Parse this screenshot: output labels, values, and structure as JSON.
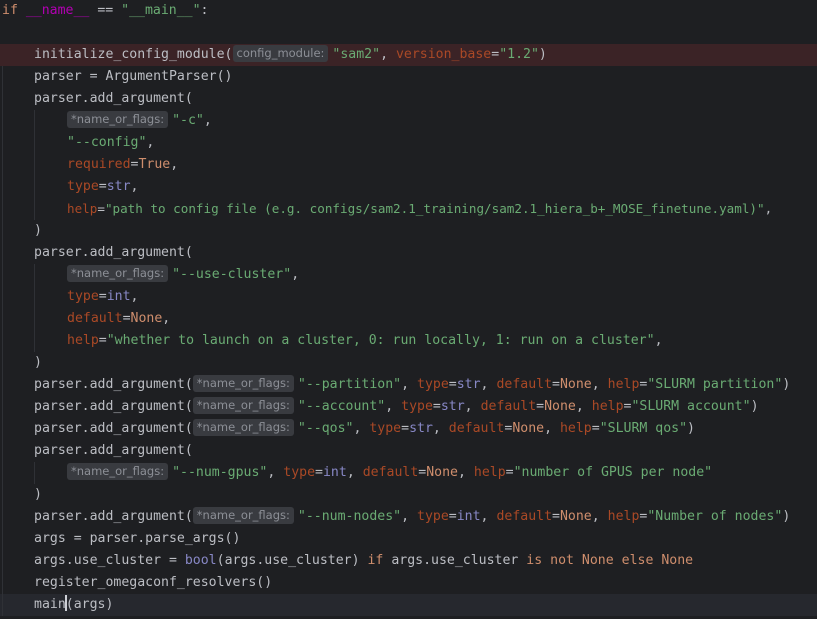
{
  "editor": {
    "colors": {
      "background": "#1e1f22",
      "breakpoint_line": "#3b2326",
      "current_line": "#26282e",
      "keyword": "#cf8e6d",
      "string": "#6aab73",
      "named_parameter": "#aa4926",
      "builtin": "#8888c6",
      "default_text": "#bcbec4",
      "inlay_hint_bg": "#393b40",
      "inlay_hint_fg": "#8c8f96"
    },
    "hints": {
      "config_module": "config_module:",
      "name_or_flags": "*name_or_flags:"
    },
    "code": {
      "l1": {
        "kw_if": "if",
        "name_dunder": "__name__",
        "eq": " == ",
        "main_str": "\"__main__\"",
        "colon": ":"
      },
      "l2": {
        "func": "initialize_config_module(",
        "arg": "\"sam2\"",
        "comma": ", ",
        "param": "version_base",
        "eq": "=",
        "val": "\"1.2\"",
        "close": ")"
      },
      "l3": {
        "text": "parser = ArgumentParser()"
      },
      "l4": {
        "text": "parser.add_argument("
      },
      "l5": {
        "arg": "\"-c\"",
        "comma": ","
      },
      "l6": {
        "arg": "\"--config\"",
        "comma": ","
      },
      "l7": {
        "param": "required",
        "eq": "=",
        "val": "True",
        "comma": ","
      },
      "l8": {
        "param": "type",
        "eq": "=",
        "val": "str",
        "comma": ","
      },
      "l9": {
        "param": "help",
        "eq": "=",
        "val": "\"path to config file (e.g. configs/sam2.1_training/sam2.1_hiera_b+_MOSE_finetune.yaml)\"",
        "comma": ","
      },
      "l10": {
        "text": ")"
      },
      "l11": {
        "text": "parser.add_argument("
      },
      "l12": {
        "arg": "\"--use-cluster\"",
        "comma": ","
      },
      "l13": {
        "param": "type",
        "eq": "=",
        "val": "int",
        "comma": ","
      },
      "l14": {
        "param": "default",
        "eq": "=",
        "val": "None",
        "comma": ","
      },
      "l15": {
        "param": "help",
        "eq": "=",
        "val": "\"whether to launch on a cluster, 0: run locally, 1: run on a cluster\"",
        "comma": ","
      },
      "l16": {
        "text": ")"
      },
      "l17": {
        "func": "parser.add_argument(",
        "arg": "\"--partition\"",
        "p1": "type",
        "v1": "str",
        "p2": "default",
        "v2": "None",
        "p3": "help",
        "v3": "\"SLURM partition\"",
        "close": ")"
      },
      "l18": {
        "func": "parser.add_argument(",
        "arg": "\"--account\"",
        "p1": "type",
        "v1": "str",
        "p2": "default",
        "v2": "None",
        "p3": "help",
        "v3": "\"SLURM account\"",
        "close": ")"
      },
      "l19": {
        "func": "parser.add_argument(",
        "arg": "\"--qos\"",
        "p1": "type",
        "v1": "str",
        "p2": "default",
        "v2": "None",
        "p3": "help",
        "v3": "\"SLURM qos\"",
        "close": ")"
      },
      "l20": {
        "text": "parser.add_argument("
      },
      "l21": {
        "arg": "\"--num-gpus\"",
        "p1": "type",
        "v1": "int",
        "p2": "default",
        "v2": "None",
        "p3": "help",
        "v3": "\"number of GPUS per node\""
      },
      "l22": {
        "text": ")"
      },
      "l23": {
        "func": "parser.add_argument(",
        "arg": "\"--num-nodes\"",
        "p1": "type",
        "v1": "int",
        "p2": "default",
        "v2": "None",
        "p3": "help",
        "v3": "\"Number of nodes\"",
        "close": ")"
      },
      "l24": {
        "text": "args = parser.parse_args()"
      },
      "l25": {
        "pre": "args.use_cluster = ",
        "builtin": "bool",
        "mid": "(args.use_cluster) ",
        "kw_if": "if",
        "mid2": " args.use_cluster ",
        "kw_is": "is",
        "sp": " ",
        "kw_not": "not",
        "sp2": " ",
        "kw_none": "None",
        "sp3": " ",
        "kw_else": "else",
        "sp4": " ",
        "kw_none2": "None"
      },
      "l26": {
        "text": "register_omegaconf_resolvers()"
      },
      "l27": {
        "before_caret": "main",
        "after_caret": "(args)"
      }
    }
  }
}
